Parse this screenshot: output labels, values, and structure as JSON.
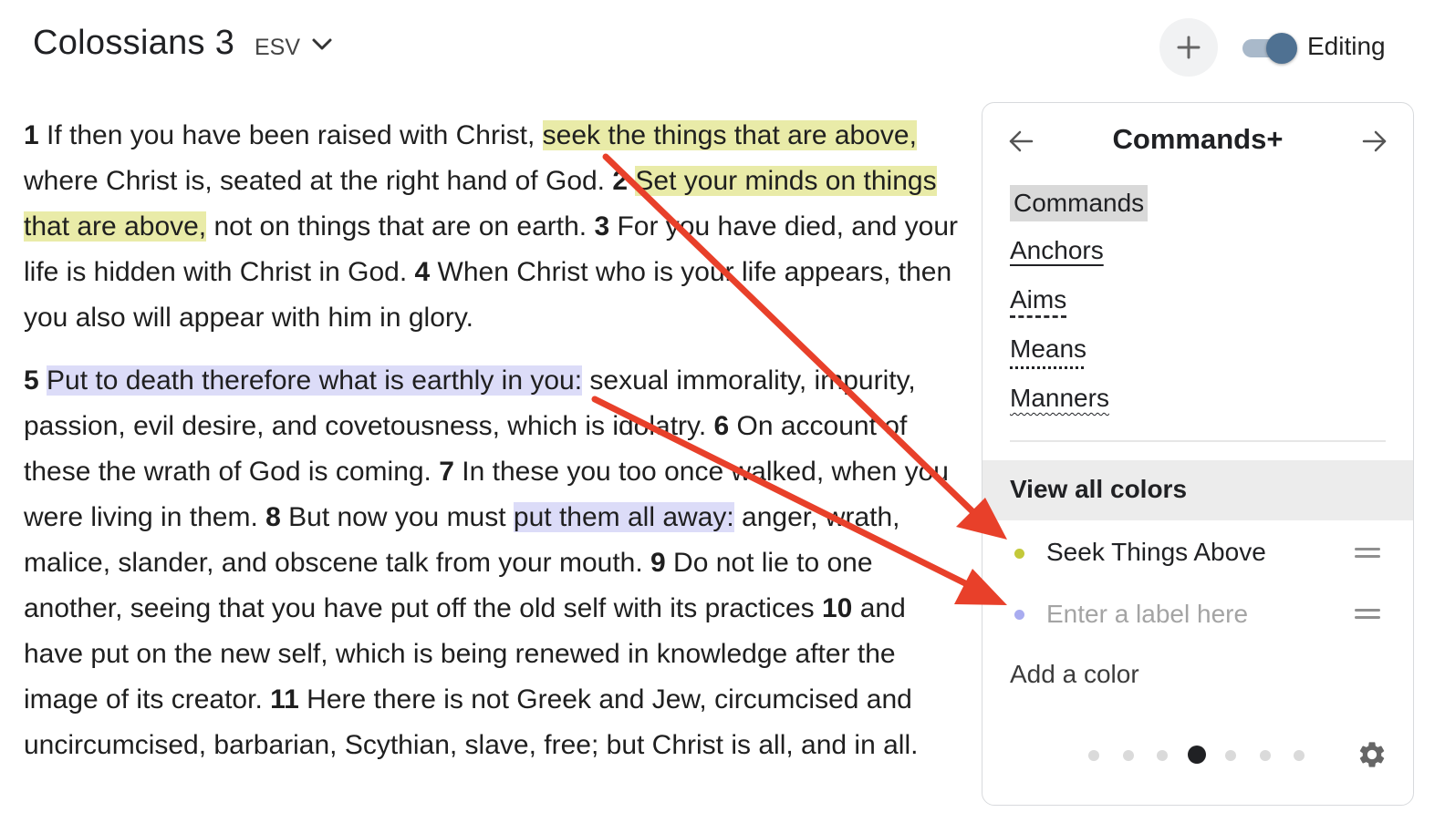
{
  "header": {
    "title": "Colossians 3",
    "version": "ESV",
    "editing_label": "Editing",
    "editing_on": true
  },
  "passage": {
    "p1": [
      {
        "t": "num",
        "v": "1"
      },
      {
        "t": "text",
        "v": " If then you have been raised with Christ, "
      },
      {
        "t": "hl-y",
        "v": "seek the things that are above,"
      },
      {
        "t": "text",
        "v": " where Christ is, seated at the right hand of God. "
      },
      {
        "t": "num",
        "v": "2"
      },
      {
        "t": "text",
        "v": " "
      },
      {
        "t": "hl-y",
        "v": "Set your minds on things that are above,"
      },
      {
        "t": "text",
        "v": " not on things that are on earth. "
      },
      {
        "t": "num",
        "v": "3"
      },
      {
        "t": "text",
        "v": " For you have died, and your life is hidden with Christ in God. "
      },
      {
        "t": "num",
        "v": "4"
      },
      {
        "t": "text",
        "v": " When Christ who is your life appears, then you also will appear with him in glory."
      }
    ],
    "p2": [
      {
        "t": "num",
        "v": "5"
      },
      {
        "t": "text",
        "v": " "
      },
      {
        "t": "hl-p",
        "v": "Put to death therefore what is earthly in you:"
      },
      {
        "t": "text",
        "v": " sexual immorality, impurity, passion, evil desire, and covetousness, which is idolatry. "
      },
      {
        "t": "num",
        "v": "6"
      },
      {
        "t": "text",
        "v": " On account of these the wrath of God is coming. "
      },
      {
        "t": "num",
        "v": "7"
      },
      {
        "t": "text",
        "v": " In these you too once walked, when you were living in them. "
      },
      {
        "t": "num",
        "v": "8"
      },
      {
        "t": "text",
        "v": " But now you must "
      },
      {
        "t": "hl-p",
        "v": "put them all away:"
      },
      {
        "t": "text",
        "v": " anger, wrath, malice, slander, and obscene talk from your mouth. "
      },
      {
        "t": "num",
        "v": "9"
      },
      {
        "t": "text",
        "v": " Do not lie to one another, seeing that you have put off the old self with its practices "
      },
      {
        "t": "num",
        "v": "10"
      },
      {
        "t": "text",
        "v": " and have put on the new self, which is being renewed in knowledge after the image of its creator. "
      },
      {
        "t": "num",
        "v": "11"
      },
      {
        "t": "text",
        "v": " Here there is not Greek and Jew, circumcised and uncircumcised, barbarian, Scythian, slave, free; but Christ is all, and in all."
      }
    ]
  },
  "panel": {
    "title": "Commands+",
    "styles": {
      "commands": "Commands",
      "anchors": "Anchors",
      "aims": "Aims",
      "means": "Means",
      "manners": "Manners"
    },
    "view_all_label": "View all colors",
    "colors": [
      {
        "label": "Seek Things Above",
        "dot_color": "#c3c93a"
      },
      {
        "label": "",
        "placeholder": "Enter a label here",
        "dot_color": "#a9acf0"
      }
    ],
    "add_color_label": "Add a color",
    "pager": {
      "total": 7,
      "active": 4
    }
  },
  "colors": {
    "highlight_yellow": "#e9eba8",
    "highlight_purple": "#dcdcf8",
    "annotation_arrow": "#e8402a",
    "toggle_knob": "#4f7192"
  },
  "icons": {
    "dropdown": "chevron-down-icon",
    "add": "plus-icon",
    "prev": "arrow-left-icon",
    "next": "arrow-right-icon",
    "settings": "gear-icon",
    "reorder": "drag-handle-icon"
  }
}
